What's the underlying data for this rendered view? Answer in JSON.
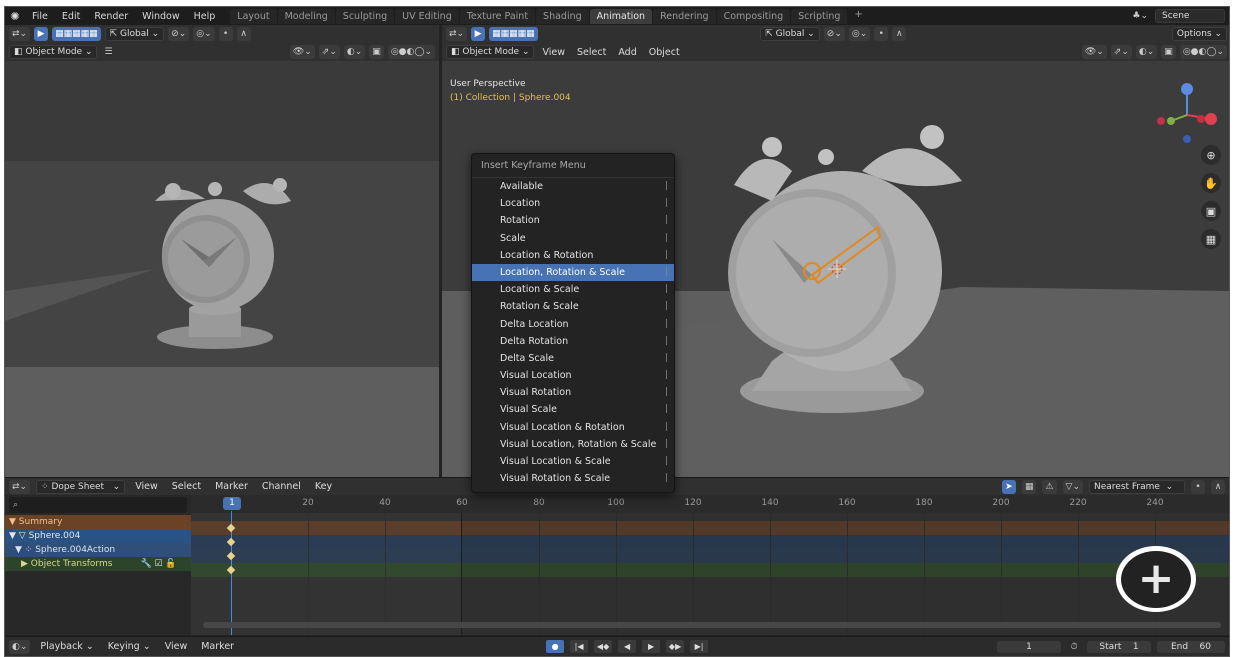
{
  "topbar": {
    "menus": [
      "File",
      "Edit",
      "Render",
      "Window",
      "Help"
    ],
    "workspaces": [
      "Layout",
      "Modeling",
      "Sculpting",
      "UV Editing",
      "Texture Paint",
      "Shading",
      "Animation",
      "Rendering",
      "Compositing",
      "Scripting"
    ],
    "active_workspace": "Animation",
    "scene": "Scene"
  },
  "left_header": {
    "transform": "Global",
    "mode": "Object Mode"
  },
  "right_header": {
    "transform": "Global",
    "options": "Options",
    "mode": "Object Mode",
    "menus": [
      "View",
      "Select",
      "Add",
      "Object"
    ]
  },
  "viewport": {
    "perspective": "User Perspective",
    "collection": "(1) Collection | Sphere.004"
  },
  "keyframe_menu": {
    "title": "Insert Keyframe Menu",
    "items": [
      "Available",
      "Location",
      "Rotation",
      "Scale",
      "Location & Rotation",
      "Location, Rotation & Scale",
      "Location & Scale",
      "Rotation & Scale",
      "Delta Location",
      "Delta Rotation",
      "Delta Scale",
      "Visual Location",
      "Visual Rotation",
      "Visual Scale",
      "Visual Location & Rotation",
      "Visual Location, Rotation & Scale",
      "Visual Location & Scale",
      "Visual Rotation & Scale"
    ],
    "selected": "Location, Rotation & Scale"
  },
  "dope_sheet": {
    "editor": "Dope Sheet",
    "menus": [
      "View",
      "Select",
      "Marker",
      "Channel",
      "Key"
    ],
    "snap": "Nearest Frame",
    "current_frame": "1",
    "ruler": [
      "20",
      "40",
      "60",
      "80",
      "100",
      "120",
      "140",
      "160",
      "180",
      "200",
      "220",
      "240"
    ],
    "channels": {
      "summary": "Summary",
      "object": "Sphere.004",
      "action": "Sphere.004Action",
      "group": "Object Transforms"
    }
  },
  "footer": {
    "menus": [
      "Playback",
      "Keying",
      "View",
      "Marker"
    ],
    "frame": "1",
    "start_label": "Start",
    "start": "1",
    "end_label": "End",
    "end": "60"
  },
  "colors": {
    "accent": "#4772b3",
    "summary": "#6a4327",
    "object_channel": "#2a5284",
    "group_channel": "#2c4429",
    "origin": "#e08a1e"
  }
}
